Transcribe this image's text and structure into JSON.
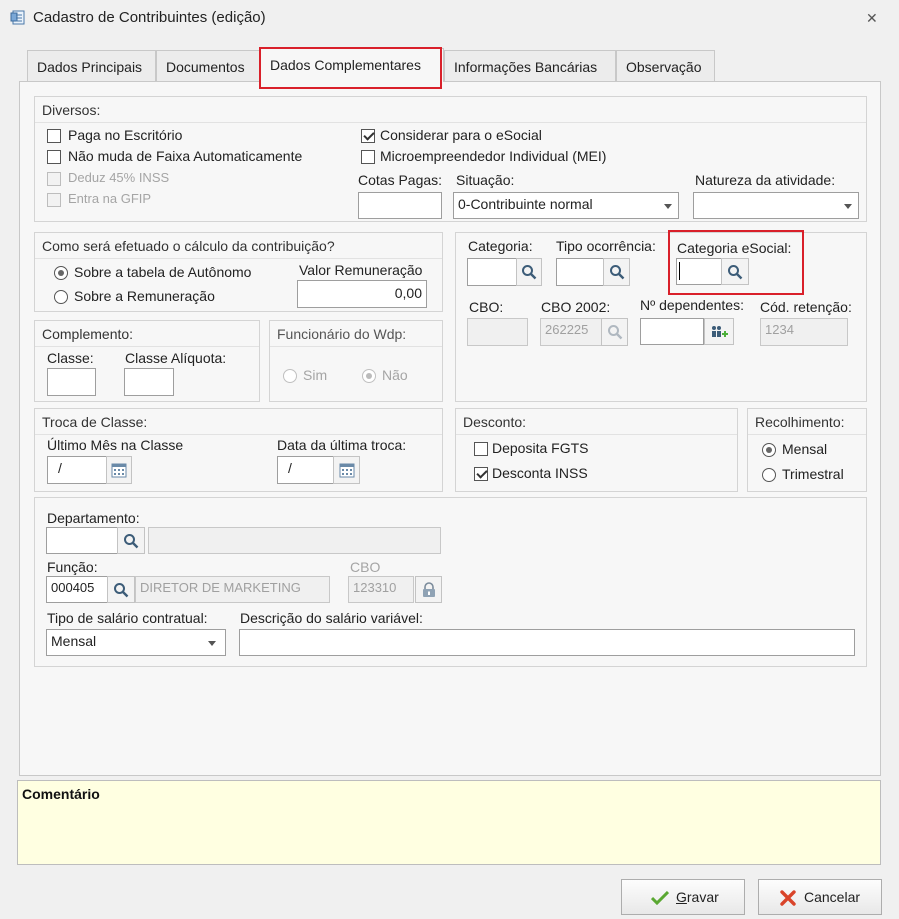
{
  "window": {
    "title": "Cadastro de Contribuintes (edição)",
    "close_glyph": "✕"
  },
  "tabs": [
    {
      "label": "Dados Principais"
    },
    {
      "label": "Documentos"
    },
    {
      "label": "Dados Complementares",
      "active": true
    },
    {
      "label": "Informações Bancárias"
    },
    {
      "label": "Observação"
    }
  ],
  "diversos": {
    "title": "Diversos:",
    "paga_escritorio": {
      "label": "Paga no Escritório",
      "checked": false
    },
    "nao_muda_faixa": {
      "label": "Não muda de Faixa Automaticamente",
      "checked": false
    },
    "deduz_inss": {
      "label": "Deduz 45% INSS",
      "checked": false,
      "disabled": true
    },
    "entra_gfip": {
      "label": "Entra na GFIP",
      "checked": false,
      "disabled": true
    },
    "considerar_esocial": {
      "label": "Considerar para o eSocial",
      "checked": true
    },
    "mei": {
      "label": "Microempreendedor Individual (MEI)",
      "checked": false
    },
    "cotas_pagas": {
      "label": "Cotas Pagas:",
      "value": ""
    },
    "situacao": {
      "label": "Situação:",
      "value": "0-Contribuinte normal"
    },
    "natureza": {
      "label": "Natureza da atividade:",
      "value": ""
    }
  },
  "calculo": {
    "title": "Como será efetuado o cálculo da contribuição?",
    "opt_autonomo": {
      "label": "Sobre a tabela de Autônomo",
      "checked": true
    },
    "opt_remuneracao": {
      "label": "Sobre a Remuneração",
      "checked": false
    },
    "valor_remuneracao": {
      "label": "Valor Remuneração",
      "value": "0,00"
    }
  },
  "complemento": {
    "title": "Complemento:",
    "classe": {
      "label": "Classe:",
      "value": ""
    },
    "classe_aliquota": {
      "label": "Classe Alíquota:",
      "value": ""
    }
  },
  "funcionario": {
    "title": "Funcionário do Wdp:",
    "sim": {
      "label": "Sim",
      "checked": false
    },
    "nao": {
      "label": "Não",
      "checked": true
    }
  },
  "categoria": {
    "categoria": {
      "label": "Categoria:",
      "value": ""
    },
    "tipo_ocorrencia": {
      "label": "Tipo ocorrência:",
      "value": ""
    },
    "categoria_esocial": {
      "label": "Categoria eSocial:",
      "value": ""
    },
    "cbo": {
      "label": "CBO:",
      "value": ""
    },
    "cbo2002": {
      "label": "CBO 2002:",
      "value": "262225"
    },
    "dependentes": {
      "label": "Nº dependentes:",
      "value": ""
    },
    "cod_retencao": {
      "label": "Cód. retenção:",
      "value": "1234"
    }
  },
  "troca": {
    "title": "Troca de Classe:",
    "ultimo_mes": {
      "label": "Último Mês na Classe",
      "value": "/"
    },
    "data_troca": {
      "label": "Data da última troca:",
      "value": "/"
    }
  },
  "desconto": {
    "title": "Desconto:",
    "fgts": {
      "label": "Deposita FGTS",
      "checked": false
    },
    "inss": {
      "label": "Desconta INSS",
      "checked": true
    }
  },
  "recolhimento": {
    "title": "Recolhimento:",
    "mensal": {
      "label": "Mensal",
      "checked": true
    },
    "trimestral": {
      "label": "Trimestral",
      "checked": false
    }
  },
  "lower": {
    "departamento": {
      "label": "Departamento:",
      "code": "",
      "name": ""
    },
    "funcao": {
      "label": "Função:",
      "code": "000405",
      "name": "DIRETOR DE MARKETING"
    },
    "cbo": {
      "label": "CBO",
      "value": "123310"
    },
    "tipo_salario": {
      "label": "Tipo de salário contratual:",
      "value": "Mensal"
    },
    "desc_salario": {
      "label": "Descrição do salário variável:",
      "value": ""
    }
  },
  "comentario": {
    "label": "Comentário"
  },
  "actions": {
    "gravar": {
      "label_first": "G",
      "label_rest": "ravar"
    },
    "cancelar": {
      "label": "Cancelar"
    }
  },
  "colors": {
    "highlight": "#d9202a",
    "comment_bg": "#ffffe1",
    "ok_green": "#5aa832",
    "cancel_red": "#d9442a"
  }
}
